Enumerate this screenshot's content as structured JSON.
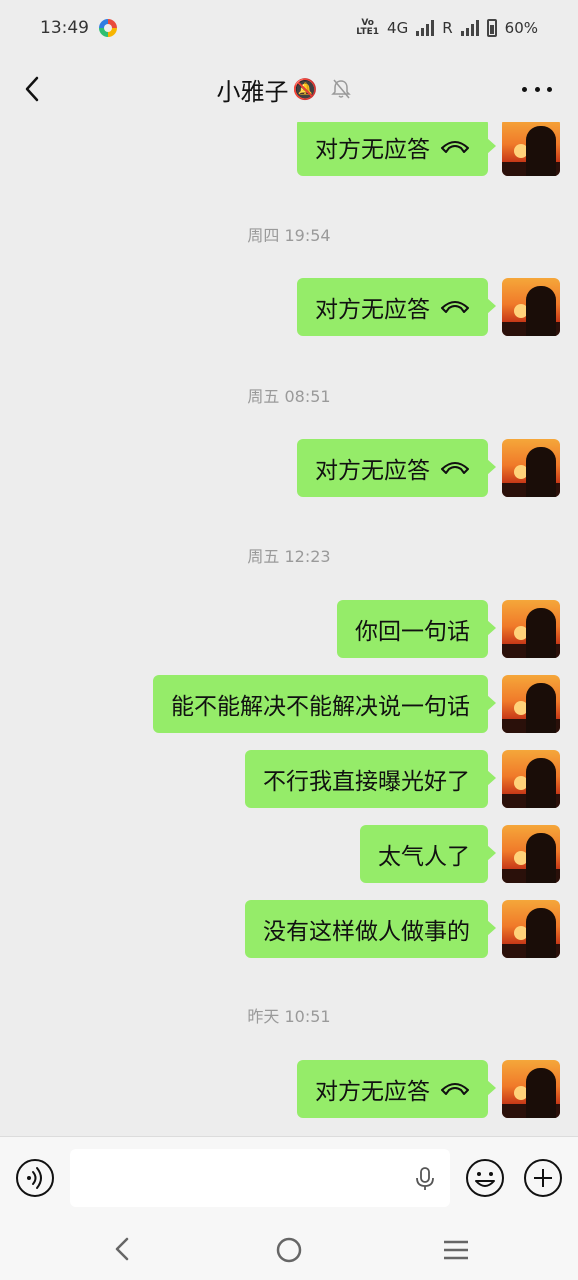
{
  "status_bar": {
    "time": "13:49",
    "volte": "VoLTE1",
    "network": "4G",
    "roaming": "R",
    "battery": "60%"
  },
  "header": {
    "title": "小雅子",
    "title_emoji": "🔕",
    "icons": [
      "back-icon",
      "mute-bell-icon",
      "more-icon"
    ]
  },
  "messages": {
    "items": [
      {
        "type": "call",
        "text": "对方无应答"
      },
      {
        "type": "time",
        "text": "周四 19:54"
      },
      {
        "type": "call",
        "text": "对方无应答"
      },
      {
        "type": "time",
        "text": "周五 08:51"
      },
      {
        "type": "call",
        "text": "对方无应答"
      },
      {
        "type": "time",
        "text": "周五 12:23"
      },
      {
        "type": "text",
        "text": "你回一句话"
      },
      {
        "type": "text",
        "text": "能不能解决不能解决说一句话"
      },
      {
        "type": "text",
        "text": "不行我直接曝光好了"
      },
      {
        "type": "text",
        "text": "太气人了"
      },
      {
        "type": "text",
        "text": "没有这样做人做事的"
      },
      {
        "type": "time",
        "text": "昨天 10:51"
      },
      {
        "type": "call",
        "text": "对方无应答"
      }
    ]
  },
  "input_bar": {
    "text_value": "",
    "icons": [
      "voice-icon",
      "mic-icon",
      "emoji-icon",
      "plus-icon"
    ]
  },
  "colors": {
    "bubble": "#95ec69",
    "background": "#ededed",
    "timestamp": "#9a9a9a"
  },
  "nav_bar": {
    "icons": [
      "nav-back-icon",
      "nav-home-icon",
      "nav-recent-icon"
    ]
  }
}
